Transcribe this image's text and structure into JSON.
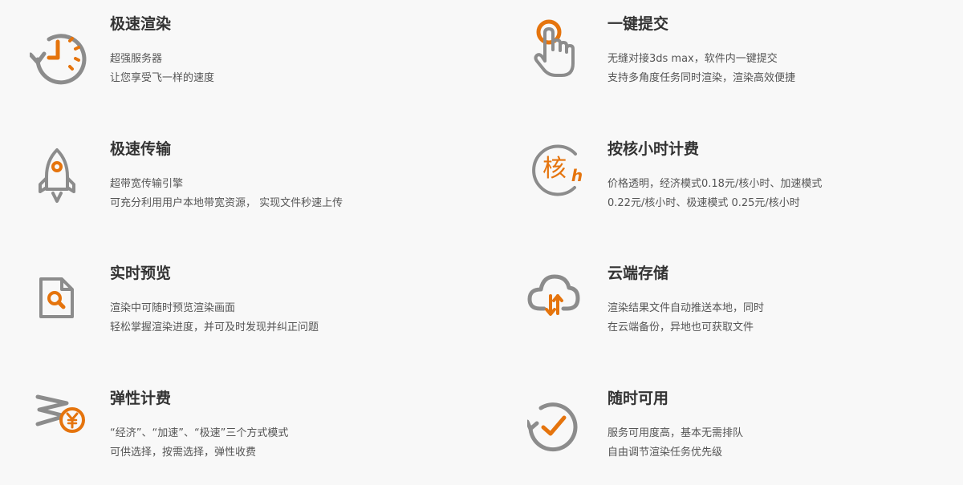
{
  "colors": {
    "accent": "#e5740d",
    "icon_gray": "#8c8c8c",
    "background": "#f8f8f8",
    "title": "#333333",
    "text": "#555555"
  },
  "features": {
    "fast_render": {
      "icon": "stopwatch-refresh-icon",
      "title": "极速渲染",
      "lines": [
        "超强服务器",
        "让您享受飞一样的速度"
      ]
    },
    "one_click": {
      "icon": "hand-tap-icon",
      "title": "一键提交",
      "lines": [
        "无缝对接3ds max，软件内一键提交",
        "支持多角度任务同时渲染，渲染高效便捷"
      ]
    },
    "fast_transfer": {
      "icon": "rocket-icon",
      "title": "极速传输",
      "lines": [
        "超带宽传输引擎",
        "可充分利用用户本地带宽资源， 实现文件秒速上传"
      ]
    },
    "core_hour": {
      "icon": "core-hour-icon",
      "icon_char": "核",
      "icon_sub": "h",
      "title": "按核小时计费",
      "lines": [
        "价格透明，经济模式0.18元/核小时、加速模式",
        "0.22元/核小时、极速模式 0.25元/核小时"
      ]
    },
    "preview": {
      "icon": "document-search-icon",
      "title": "实时预览",
      "lines": [
        "渲染中可随时预览渲染画面",
        "轻松掌握渲染进度，并可及时发现并纠正问题"
      ]
    },
    "cloud_storage": {
      "icon": "cloud-sync-icon",
      "title": "云端存储",
      "lines": [
        "渲染结果文件自动推送本地，同时",
        "在云端备份，异地也可获取文件"
      ]
    },
    "flexible_billing": {
      "icon": "yen-coin-icon",
      "title": "弹性计费",
      "lines": [
        "“经济”、“加速”、“极速”三个方式模式",
        "可供选择，按需选择，弹性收费"
      ]
    },
    "anytime": {
      "icon": "refresh-check-icon",
      "title": "随时可用",
      "lines": [
        "服务可用度高，基本无需排队",
        "自由调节渲染任务优先级"
      ]
    }
  }
}
